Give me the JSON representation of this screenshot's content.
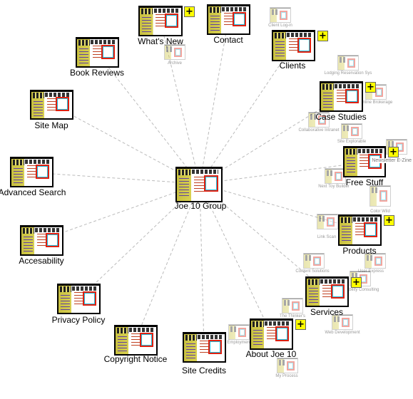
{
  "center": {
    "label": "Joe 10 Group"
  },
  "nodes": [
    {
      "label": "What's New",
      "expandable": true
    },
    {
      "label": "Contact",
      "expandable": false
    },
    {
      "label": "Book Reviews",
      "expandable": false
    },
    {
      "label": "Site Map",
      "expandable": false
    },
    {
      "label": "Advanced Search",
      "expandable": false
    },
    {
      "label": "Accesability",
      "expandable": false
    },
    {
      "label": "Privacy Policy",
      "expandable": false
    },
    {
      "label": "Copyright Notice",
      "expandable": false
    },
    {
      "label": "Site Credits",
      "expandable": false
    },
    {
      "label": "About Joe 10",
      "expandable": true
    },
    {
      "label": "Services",
      "expandable": true
    },
    {
      "label": "Products",
      "expandable": true
    },
    {
      "label": "Free Stuff",
      "expandable": true
    },
    {
      "label": "Case Studies",
      "expandable": true
    },
    {
      "label": "Clients",
      "expandable": true
    }
  ],
  "subpages": [
    "Archive",
    "Client Log-in",
    "Lodging Reservation Sys",
    "Online Brokerage",
    "Collaborative Intranet",
    "Site Explorable",
    "Newsletter E-Zine",
    "Next Toy Builder",
    "Color Wild",
    "Link Scan",
    "Content Solutions",
    "User Express",
    "Usability Consulting",
    "The Thinker's",
    "Web Development",
    "Employment",
    "My Process"
  ],
  "expand_icon": "+",
  "colors": {
    "expand": "#ffff00",
    "line": "#bbbbbb"
  }
}
